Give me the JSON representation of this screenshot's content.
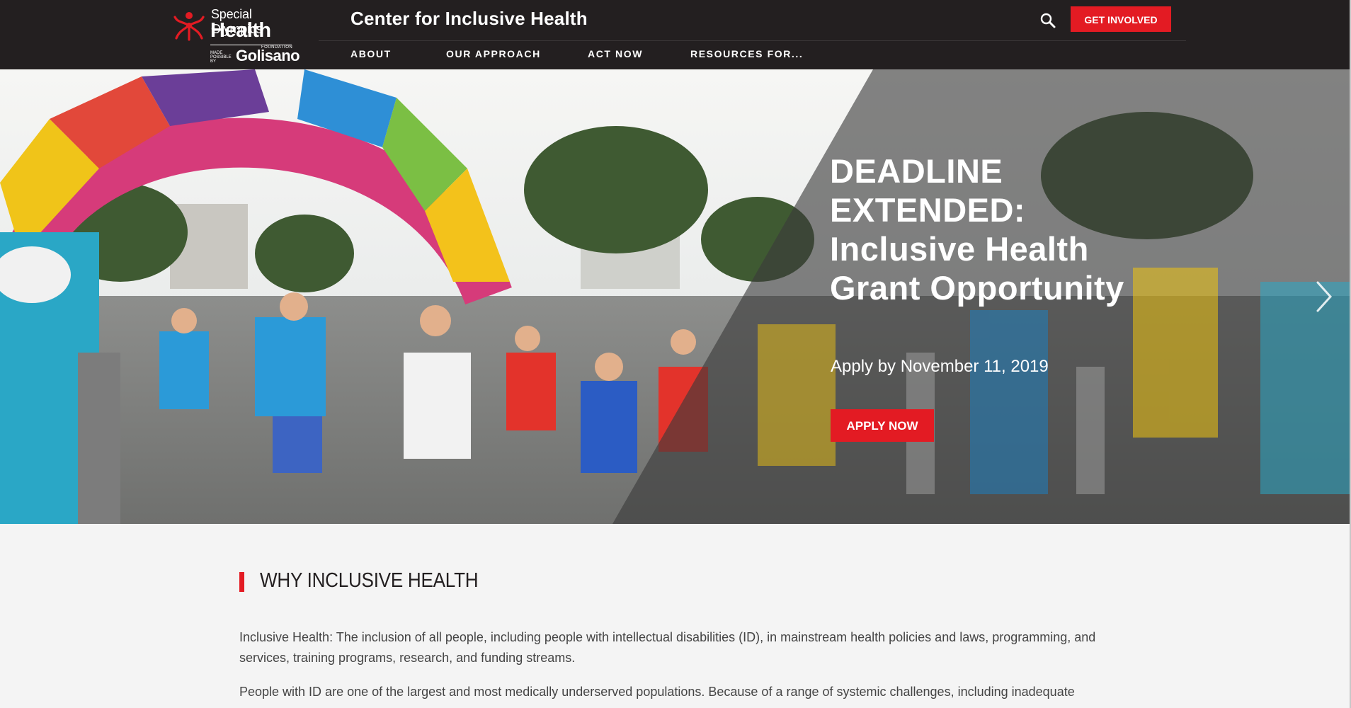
{
  "logo": {
    "line1": "Special Olympics",
    "line2": "Health",
    "made_possible": "MADE POSSIBLE BY",
    "foundation": "FOUNDATION",
    "sponsor": "Golisano"
  },
  "header": {
    "site_title": "Center for Inclusive Health",
    "search_icon": "search-icon",
    "cta_label": "GET INVOLVED",
    "accent_color": "#e31b23",
    "background_color": "#231f20"
  },
  "nav": {
    "items": [
      {
        "label": "ABOUT"
      },
      {
        "label": "OUR APPROACH"
      },
      {
        "label": "ACT NOW"
      },
      {
        "label": "RESOURCES FOR..."
      }
    ]
  },
  "hero": {
    "heading": "DEADLINE EXTENDED: Inclusive Health Grant Opportunity",
    "subheading": "Apply by November 11, 2019",
    "button_label": "APPLY NOW",
    "next_icon": "chevron-right-icon"
  },
  "main": {
    "section_title": "WHY INCLUSIVE HEALTH",
    "paragraphs": [
      "Inclusive Health: The inclusion of all people, including people with intellectual disabilities (ID), in mainstream health policies and laws, programming, and services, training programs, research, and funding streams.",
      "People with ID are one of the largest and most medically underserved populations. Because of a range of systemic challenges, including inadequate"
    ]
  }
}
